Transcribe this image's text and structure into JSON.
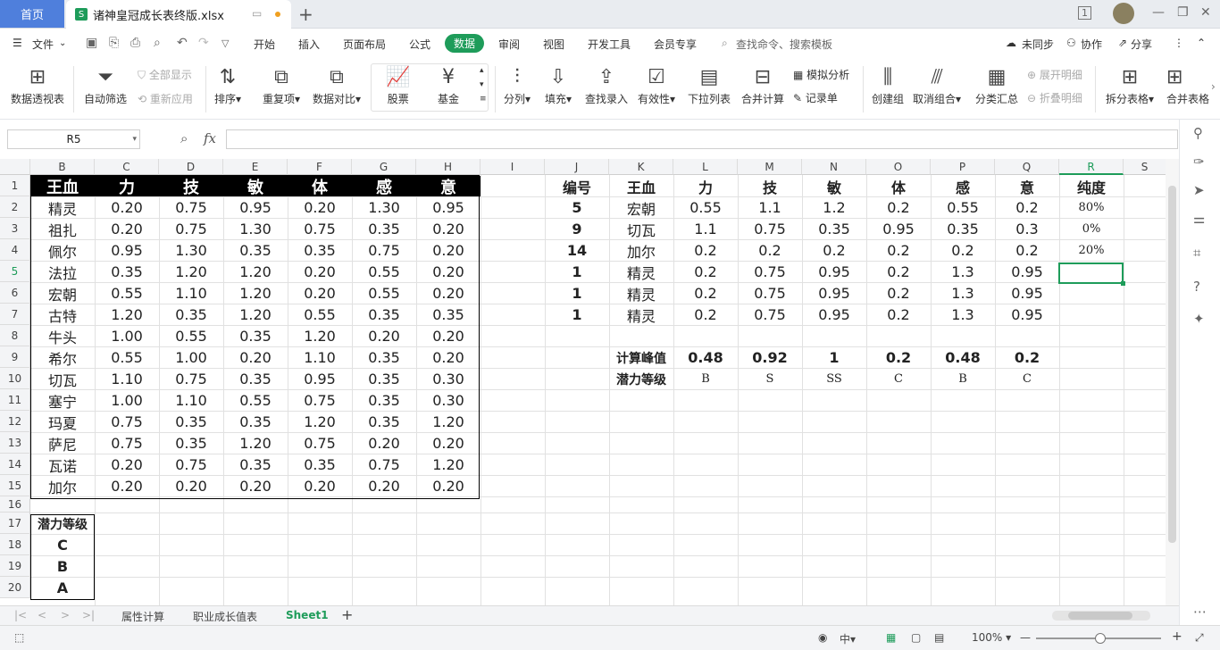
{
  "window": {
    "home_tab": "首页",
    "file_tab": "诸神皇冠成长表终版.xlsx",
    "file_icon": "S",
    "page_badge": "1"
  },
  "menu": {
    "file_label": "文件",
    "items": [
      "开始",
      "插入",
      "页面布局",
      "公式",
      "数据",
      "审阅",
      "视图",
      "开发工具",
      "会员专享"
    ],
    "active_item": "数据",
    "search_placeholder": "查找命令、搜索模板",
    "sync": "未同步",
    "collab": "协作",
    "share": "分享"
  },
  "ribbon": {
    "pivot": "数据透视表",
    "autofilter": "自动筛选",
    "show_all": "全部显示",
    "reapply": "重新应用",
    "sort": "排序",
    "duplicates": "重复项",
    "compare": "数据对比",
    "stock": "股票",
    "fund": "基金",
    "split": "分列",
    "fill": "填充",
    "lookup_entry": "查找录入",
    "validity": "有效性",
    "dropdown": "下拉列表",
    "consolidate": "合并计算",
    "simulate": "模拟分析",
    "record": "记录单",
    "create_group": "创建组",
    "ungroup": "取消组合",
    "subtotal": "分类汇总",
    "expand_detail": "展开明细",
    "collapse_detail": "折叠明细",
    "split_table": "拆分表格",
    "merge_table": "合并表格"
  },
  "formula_bar": {
    "name_box": "R5",
    "fx": "fx",
    "content": ""
  },
  "grid": {
    "columns": [
      "B",
      "C",
      "D",
      "E",
      "F",
      "G",
      "H",
      "I",
      "J",
      "K",
      "L",
      "M",
      "N",
      "O",
      "P",
      "Q",
      "R",
      "S"
    ],
    "selected_column": "R",
    "rows": [
      "1",
      "2",
      "3",
      "4",
      "5",
      "6",
      "7",
      "8",
      "9",
      "10",
      "11",
      "12",
      "13",
      "14",
      "15",
      "16",
      "17",
      "18",
      "19",
      "20"
    ],
    "selected_row": "5"
  },
  "table1": {
    "headers": [
      "王血",
      "力",
      "技",
      "敏",
      "体",
      "感",
      "意"
    ],
    "rows": [
      [
        "精灵",
        "0.20",
        "0.75",
        "0.95",
        "0.20",
        "1.30",
        "0.95"
      ],
      [
        "祖扎",
        "0.20",
        "0.75",
        "1.30",
        "0.75",
        "0.35",
        "0.20"
      ],
      [
        "佩尔",
        "0.95",
        "1.30",
        "0.35",
        "0.35",
        "0.75",
        "0.20"
      ],
      [
        "法拉",
        "0.35",
        "1.20",
        "1.20",
        "0.20",
        "0.55",
        "0.20"
      ],
      [
        "宏朝",
        "0.55",
        "1.10",
        "1.20",
        "0.20",
        "0.55",
        "0.20"
      ],
      [
        "古特",
        "1.20",
        "0.35",
        "1.20",
        "0.55",
        "0.35",
        "0.35"
      ],
      [
        "牛头",
        "1.00",
        "0.55",
        "0.35",
        "1.20",
        "0.20",
        "0.20"
      ],
      [
        "希尔",
        "0.55",
        "1.00",
        "0.20",
        "1.10",
        "0.35",
        "0.20"
      ],
      [
        "切瓦",
        "1.10",
        "0.75",
        "0.35",
        "0.95",
        "0.35",
        "0.30"
      ],
      [
        "塞宁",
        "1.00",
        "1.10",
        "0.55",
        "0.75",
        "0.35",
        "0.30"
      ],
      [
        "玛夏",
        "0.75",
        "0.35",
        "0.35",
        "1.20",
        "0.35",
        "1.20"
      ],
      [
        "萨尼",
        "0.75",
        "0.35",
        "1.20",
        "0.75",
        "0.20",
        "0.20"
      ],
      [
        "瓦诺",
        "0.20",
        "0.75",
        "0.35",
        "0.35",
        "0.75",
        "1.20"
      ],
      [
        "加尔",
        "0.20",
        "0.20",
        "0.20",
        "0.20",
        "0.20",
        "0.20"
      ]
    ]
  },
  "potential_list": {
    "header": "潜力等级",
    "items": [
      "C",
      "B",
      "A"
    ]
  },
  "table2": {
    "headers": [
      "编号",
      "王血",
      "力",
      "技",
      "敏",
      "体",
      "感",
      "意",
      "纯度"
    ],
    "rows": [
      [
        "5",
        "宏朝",
        "0.55",
        "1.1",
        "1.2",
        "0.2",
        "0.55",
        "0.2",
        "80%"
      ],
      [
        "9",
        "切瓦",
        "1.1",
        "0.75",
        "0.35",
        "0.95",
        "0.35",
        "0.3",
        "0%"
      ],
      [
        "14",
        "加尔",
        "0.2",
        "0.2",
        "0.2",
        "0.2",
        "0.2",
        "0.2",
        "20%"
      ],
      [
        "1",
        "精灵",
        "0.2",
        "0.75",
        "0.95",
        "0.2",
        "1.3",
        "0.95",
        ""
      ],
      [
        "1",
        "精灵",
        "0.2",
        "0.75",
        "0.95",
        "0.2",
        "1.3",
        "0.95",
        ""
      ],
      [
        "1",
        "精灵",
        "0.2",
        "0.75",
        "0.95",
        "0.2",
        "1.3",
        "0.95",
        ""
      ]
    ],
    "peak_label": "计算峰值",
    "peak_values": [
      "0.48",
      "0.92",
      "1",
      "0.2",
      "0.48",
      "0.2"
    ],
    "level_label": "潜力等级",
    "level_values": [
      "B",
      "S",
      "SS",
      "C",
      "B",
      "C"
    ]
  },
  "sheets": {
    "tabs": [
      "属性计算",
      "职业成长值表",
      "Sheet1"
    ],
    "active": "Sheet1"
  },
  "status": {
    "zoom": "100%"
  },
  "colors": {
    "accent": "#1e9c5a",
    "home_tab": "#4f7fdc",
    "header_fill": "#000000"
  }
}
